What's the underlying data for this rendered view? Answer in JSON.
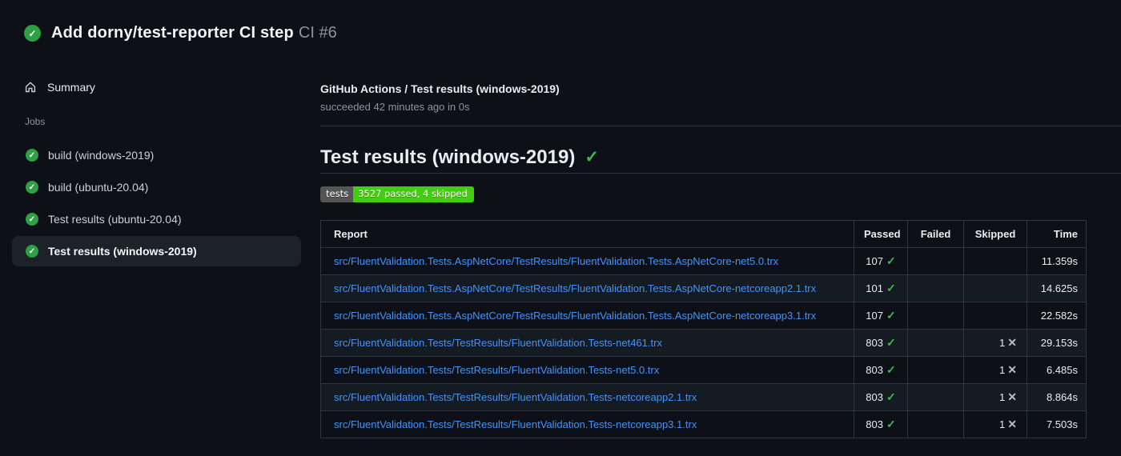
{
  "run": {
    "title": "Add dorny/test-reporter CI step",
    "number": "CI #6"
  },
  "sidebar": {
    "summary_label": "Summary",
    "jobs_heading": "Jobs",
    "jobs": [
      {
        "label": "build (windows-2019)",
        "status": "success"
      },
      {
        "label": "build (ubuntu-20.04)",
        "status": "success"
      },
      {
        "label": "Test results (ubuntu-20.04)",
        "status": "success"
      },
      {
        "label": "Test results (windows-2019)",
        "status": "success"
      }
    ]
  },
  "check": {
    "name": "GitHub Actions / Test results (windows-2019)",
    "status": "succeeded 42 minutes ago in 0s"
  },
  "section": {
    "heading": "Test results (windows-2019)",
    "heading_check": "✓",
    "badge": {
      "label": "tests",
      "value": "3527 passed, 4 skipped"
    }
  },
  "table": {
    "headers": {
      "report": "Report",
      "passed": "Passed",
      "failed": "Failed",
      "skipped": "Skipped",
      "time": "Time"
    },
    "rows": [
      {
        "report": "src/FluentValidation.Tests.AspNetCore/TestResults/FluentValidation.Tests.AspNetCore-net5.0.trx",
        "passed": "107",
        "failed": "",
        "skipped": "",
        "time": "11.359s"
      },
      {
        "report": "src/FluentValidation.Tests.AspNetCore/TestResults/FluentValidation.Tests.AspNetCore-netcoreapp2.1.trx",
        "passed": "101",
        "failed": "",
        "skipped": "",
        "time": "14.625s"
      },
      {
        "report": "src/FluentValidation.Tests.AspNetCore/TestResults/FluentValidation.Tests.AspNetCore-netcoreapp3.1.trx",
        "passed": "107",
        "failed": "",
        "skipped": "",
        "time": "22.582s"
      },
      {
        "report": "src/FluentValidation.Tests/TestResults/FluentValidation.Tests-net461.trx",
        "passed": "803",
        "failed": "",
        "skipped": "1",
        "time": "29.153s"
      },
      {
        "report": "src/FluentValidation.Tests/TestResults/FluentValidation.Tests-net5.0.trx",
        "passed": "803",
        "failed": "",
        "skipped": "1",
        "time": "6.485s"
      },
      {
        "report": "src/FluentValidation.Tests/TestResults/FluentValidation.Tests-netcoreapp2.1.trx",
        "passed": "803",
        "failed": "",
        "skipped": "1",
        "time": "8.864s"
      },
      {
        "report": "src/FluentValidation.Tests/TestResults/FluentValidation.Tests-netcoreapp3.1.trx",
        "passed": "803",
        "failed": "",
        "skipped": "1",
        "time": "7.503s"
      }
    ]
  },
  "icons": {
    "check": "✓",
    "cross": "✕"
  },
  "colors": {
    "background": "#0d1117",
    "success_circle": "#2ea043",
    "check_green": "#3fb950",
    "link_blue": "#4493f8",
    "badge_label_bg": "#555555",
    "badge_value_bg": "#44cc11",
    "border": "#30363d"
  }
}
